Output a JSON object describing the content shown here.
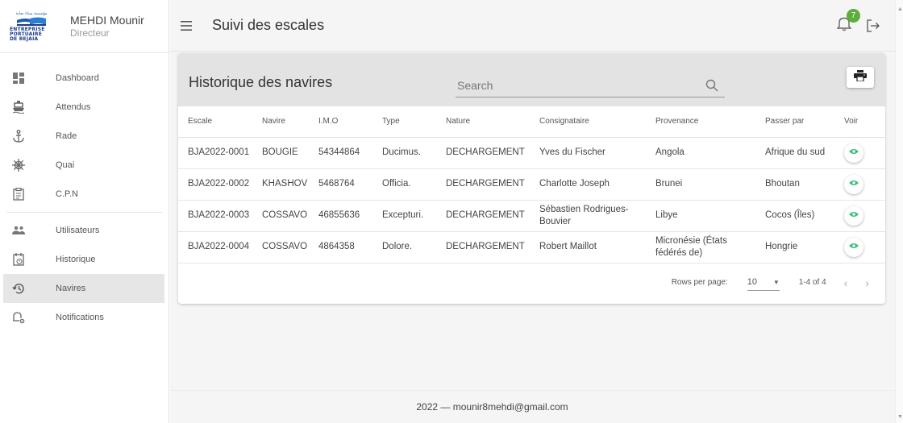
{
  "sidebar": {
    "logo": {
      "arabic": "مؤسسة ميناء بجاية",
      "line1": "ENTREPRISE",
      "line2": "PORTUAIRE",
      "line3": "DE BEJAIA"
    },
    "user_name": "MEHDI Mounir",
    "user_role": "Directeur",
    "items": [
      {
        "label": "Dashboard",
        "icon": "dashboard-icon"
      },
      {
        "label": "Attendus",
        "icon": "ship-icon"
      },
      {
        "label": "Rade",
        "icon": "anchor-icon"
      },
      {
        "label": "Quai",
        "icon": "ship-wheel-icon"
      },
      {
        "label": "C.P.N",
        "icon": "clipboard-icon"
      },
      {
        "label": "Utilisateurs",
        "icon": "users-icon"
      },
      {
        "label": "Historique",
        "icon": "calendar-history-icon"
      },
      {
        "label": "Navires",
        "icon": "history-icon"
      },
      {
        "label": "Notifications",
        "icon": "bell-settings-icon"
      }
    ],
    "active": "Navires"
  },
  "topbar": {
    "title": "Suivi des escales",
    "notification_count": "7"
  },
  "card": {
    "title": "Historique des navires",
    "search_placeholder": "Search"
  },
  "table": {
    "headers": [
      "Escale",
      "Navire",
      "I.M.O",
      "Type",
      "Nature",
      "Consignataire",
      "Provenance",
      "Passer par",
      "Voir"
    ],
    "rows": [
      {
        "escale": "BJA2022-0001",
        "navire": "BOUGIE",
        "imo": "54344864",
        "type": "Ducimus.",
        "nature": "DECHARGEMENT",
        "consignataire": "Yves du Fischer",
        "provenance": "Angola",
        "passer_par": "Afrique du sud"
      },
      {
        "escale": "BJA2022-0002",
        "navire": "KHASHOV",
        "imo": "5468764",
        "type": "Officia.",
        "nature": "DECHARGEMENT",
        "consignataire": "Charlotte Joseph",
        "provenance": "Brunei",
        "passer_par": "Bhoutan"
      },
      {
        "escale": "BJA2022-0003",
        "navire": "COSSAVO",
        "imo": "46855636",
        "type": "Excepturi.",
        "nature": "DECHARGEMENT",
        "consignataire": "Sébastien Rodrigues-Bouvier",
        "provenance": "Libye",
        "passer_par": "Cocos (Îles)"
      },
      {
        "escale": "BJA2022-0004",
        "navire": "COSSAVO",
        "imo": "4864358",
        "type": "Dolore.",
        "nature": "DECHARGEMENT",
        "consignataire": "Robert Maillot",
        "provenance": "Micronésie (États fédérés de)",
        "passer_par": "Hongrie"
      }
    ]
  },
  "pagination": {
    "rows_per_page_label": "Rows per page:",
    "rows_per_page": "10",
    "range": "1-4 of 4"
  },
  "footer": {
    "text": "2022 — mounir8mehdi@gmail.com"
  },
  "colors": {
    "accent_green": "#5cae3a",
    "eye_green": "#3fbf7f"
  }
}
